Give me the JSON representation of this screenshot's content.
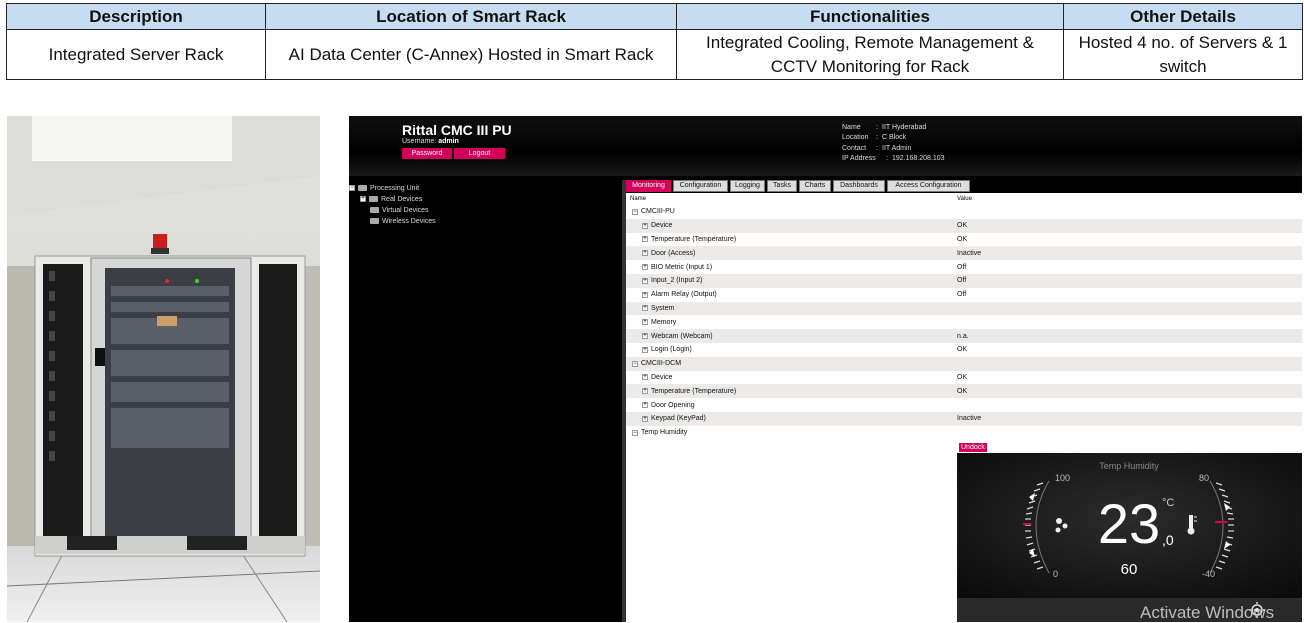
{
  "table": {
    "headers": [
      "Description",
      "Location of Smart Rack",
      "Functionalities",
      "Other Details"
    ],
    "row": [
      "Integrated Server Rack",
      "AI Data Center (C-Annex) Hosted in Smart Rack",
      "Integrated Cooling, Remote Management & CCTV Monitoring for Rack",
      "Hosted 4 no. of Servers & 1 switch"
    ]
  },
  "cmc": {
    "title": "Rittal CMC III PU",
    "username_label": "Username:",
    "username": "admin",
    "password_button": "Password",
    "logout_button": "Logout",
    "info": [
      {
        "key": "Name",
        "value": "IIT Hyderabad"
      },
      {
        "key": "Location",
        "value": "C Block"
      },
      {
        "key": "Contact",
        "value": "IIT Admin"
      },
      {
        "key": "IP Address",
        "value": "192.168.208.103"
      }
    ],
    "tree": [
      "Processing Unit",
      "Real Devices",
      "Virtual Devices",
      "Wireless Devices"
    ],
    "tabs": [
      "Monitoring",
      "Configuration",
      "Logging",
      "Tasks",
      "Charts",
      "Dashboards",
      "Access Configuration"
    ],
    "columns": {
      "name": "Name",
      "value": "Value"
    },
    "rows": [
      {
        "name": "CMCIII-PU",
        "value": ""
      },
      {
        "name": "Device",
        "value": "OK"
      },
      {
        "name": "Temperature (Temperature)",
        "value": "OK"
      },
      {
        "name": "Door (Access)",
        "value": "Inactive"
      },
      {
        "name": "BIO Metric (Input 1)",
        "value": "Off"
      },
      {
        "name": "Input_2 (Input 2)",
        "value": "Off"
      },
      {
        "name": "Alarm Relay (Output)",
        "value": "Off"
      },
      {
        "name": "System",
        "value": ""
      },
      {
        "name": "Memory",
        "value": ""
      },
      {
        "name": "Webcam (Webcam)",
        "value": "n.a."
      },
      {
        "name": "Login (Login)",
        "value": "OK"
      },
      {
        "name": "CMCIII-DCM",
        "value": ""
      },
      {
        "name": "Device",
        "value": "OK"
      },
      {
        "name": "Temperature (Temperature)",
        "value": "OK"
      },
      {
        "name": "Door Opening",
        "value": ""
      },
      {
        "name": "Keypad (KeyPad)",
        "value": "Inactive"
      },
      {
        "name": "Temp Humidity",
        "value": ""
      }
    ],
    "undock_button": "Undock",
    "widget": {
      "title": "Temp Humidity",
      "temperature": "23",
      "decimal": ",0",
      "unit": "°C",
      "humidity": "60",
      "left_max": "100",
      "left_min": "0",
      "right_max": "80",
      "right_min": "-40"
    }
  },
  "watermark": "Activate Windows",
  "colors": {
    "accent": "#d4005a",
    "header_bg": "#000000",
    "table_header": "#c6dcf0"
  }
}
